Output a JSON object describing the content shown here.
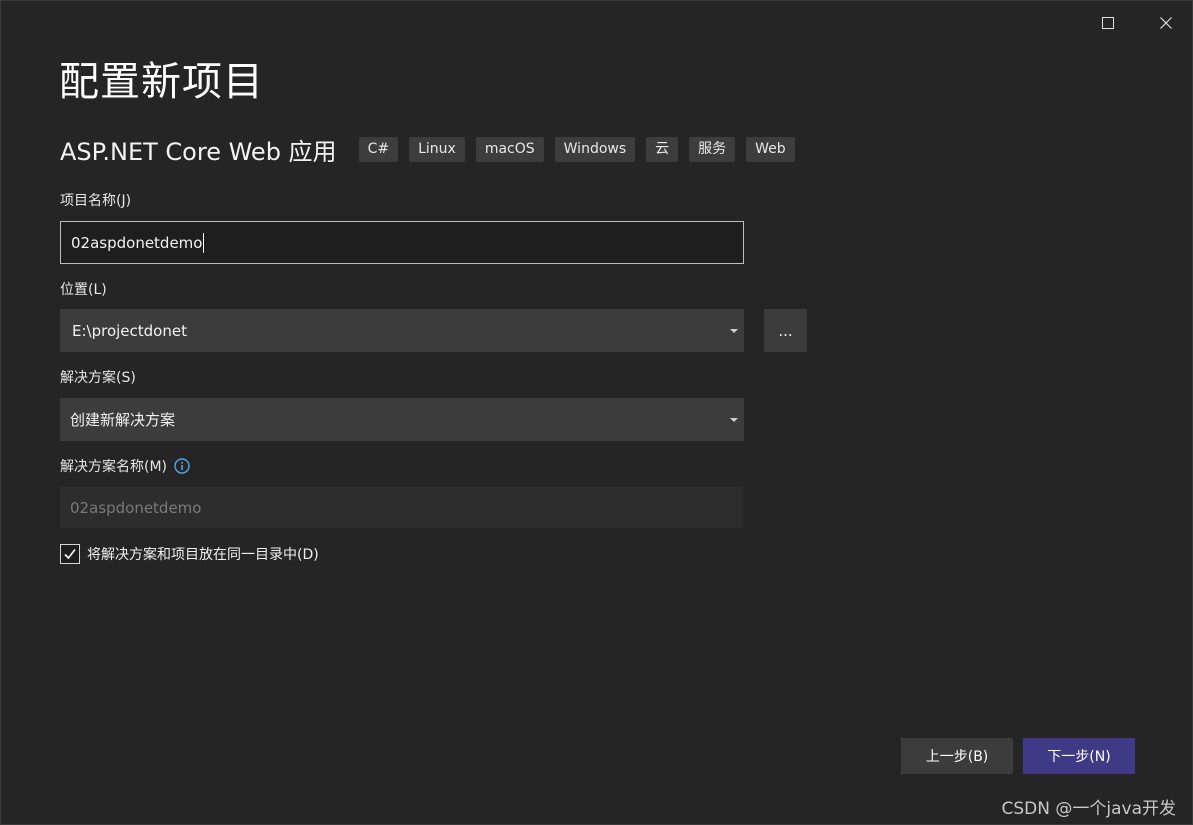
{
  "window": {
    "maximize_icon": "maximize-icon",
    "close_icon": "close-icon"
  },
  "page": {
    "title": "配置新项目"
  },
  "template": {
    "name": "ASP.NET Core Web 应用",
    "tags": [
      "C#",
      "Linux",
      "macOS",
      "Windows",
      "云",
      "服务",
      "Web"
    ]
  },
  "project_name": {
    "label": "项目名称(J)",
    "value": "02aspdonetdemo"
  },
  "location": {
    "label": "位置(L)",
    "value": "E:\\projectdonet",
    "browse_label": "..."
  },
  "solution": {
    "label": "解决方案(S)",
    "value": "创建新解决方案"
  },
  "solution_name": {
    "label": "解决方案名称(M)",
    "value": "02aspdonetdemo",
    "info_icon": "info-icon"
  },
  "same_directory": {
    "label": "将解决方案和项目放在同一目录中(D)",
    "checked": true
  },
  "footer": {
    "back_label": "上一步(B)",
    "next_label": "下一步(N)"
  },
  "watermark": "CSDN @一个java开发",
  "colors": {
    "background": "#252526",
    "input_bg": "#3c3c3c",
    "primary_button": "#3f3a85",
    "info_icon": "#4fa8e8"
  }
}
